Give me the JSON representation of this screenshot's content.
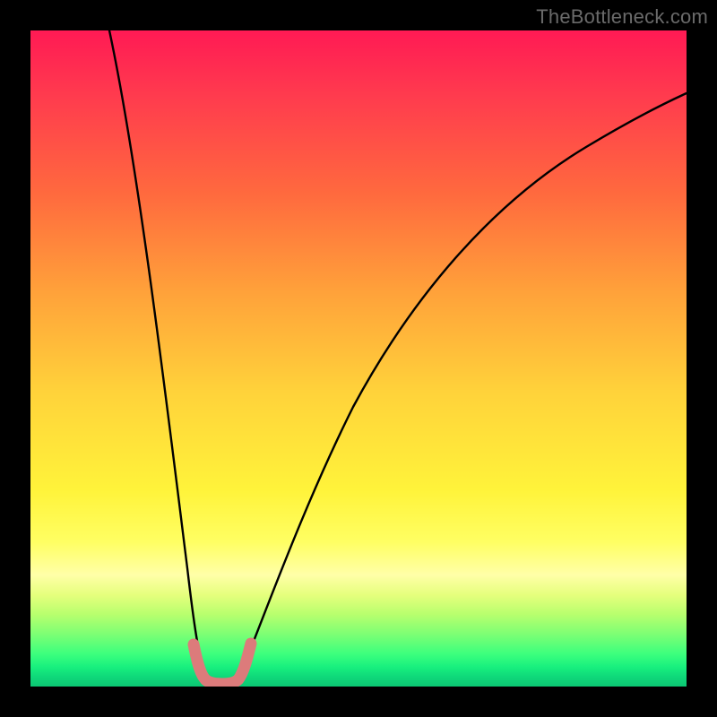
{
  "watermark": "TheBottleneck.com",
  "chart_data": {
    "type": "line",
    "title": "",
    "xlabel": "",
    "ylabel": "",
    "xlim": [
      0,
      100
    ],
    "ylim": [
      0,
      100
    ],
    "background_gradient_meaning": "green (bottom) = good / low bottleneck, red (top) = high bottleneck",
    "series": [
      {
        "name": "bottleneck-curve",
        "stroke": "#000000",
        "x": [
          12,
          14,
          16,
          18,
          20,
          22,
          24,
          25,
          26,
          27,
          28,
          30,
          32,
          36,
          40,
          45,
          50,
          55,
          60,
          65,
          70,
          75,
          80,
          85,
          90,
          95,
          100
        ],
        "y": [
          100,
          90,
          80,
          68,
          56,
          42,
          24,
          12,
          4,
          0,
          0,
          0,
          4,
          18,
          30,
          42,
          52,
          60,
          66,
          71,
          75,
          78,
          81,
          83,
          85,
          87,
          88
        ]
      },
      {
        "name": "highlight-band",
        "stroke": "#e07a7a",
        "x": [
          25,
          26,
          27,
          28,
          29,
          30,
          31,
          32
        ],
        "y": [
          12,
          4,
          0,
          0,
          0,
          0,
          4,
          10
        ]
      }
    ]
  }
}
